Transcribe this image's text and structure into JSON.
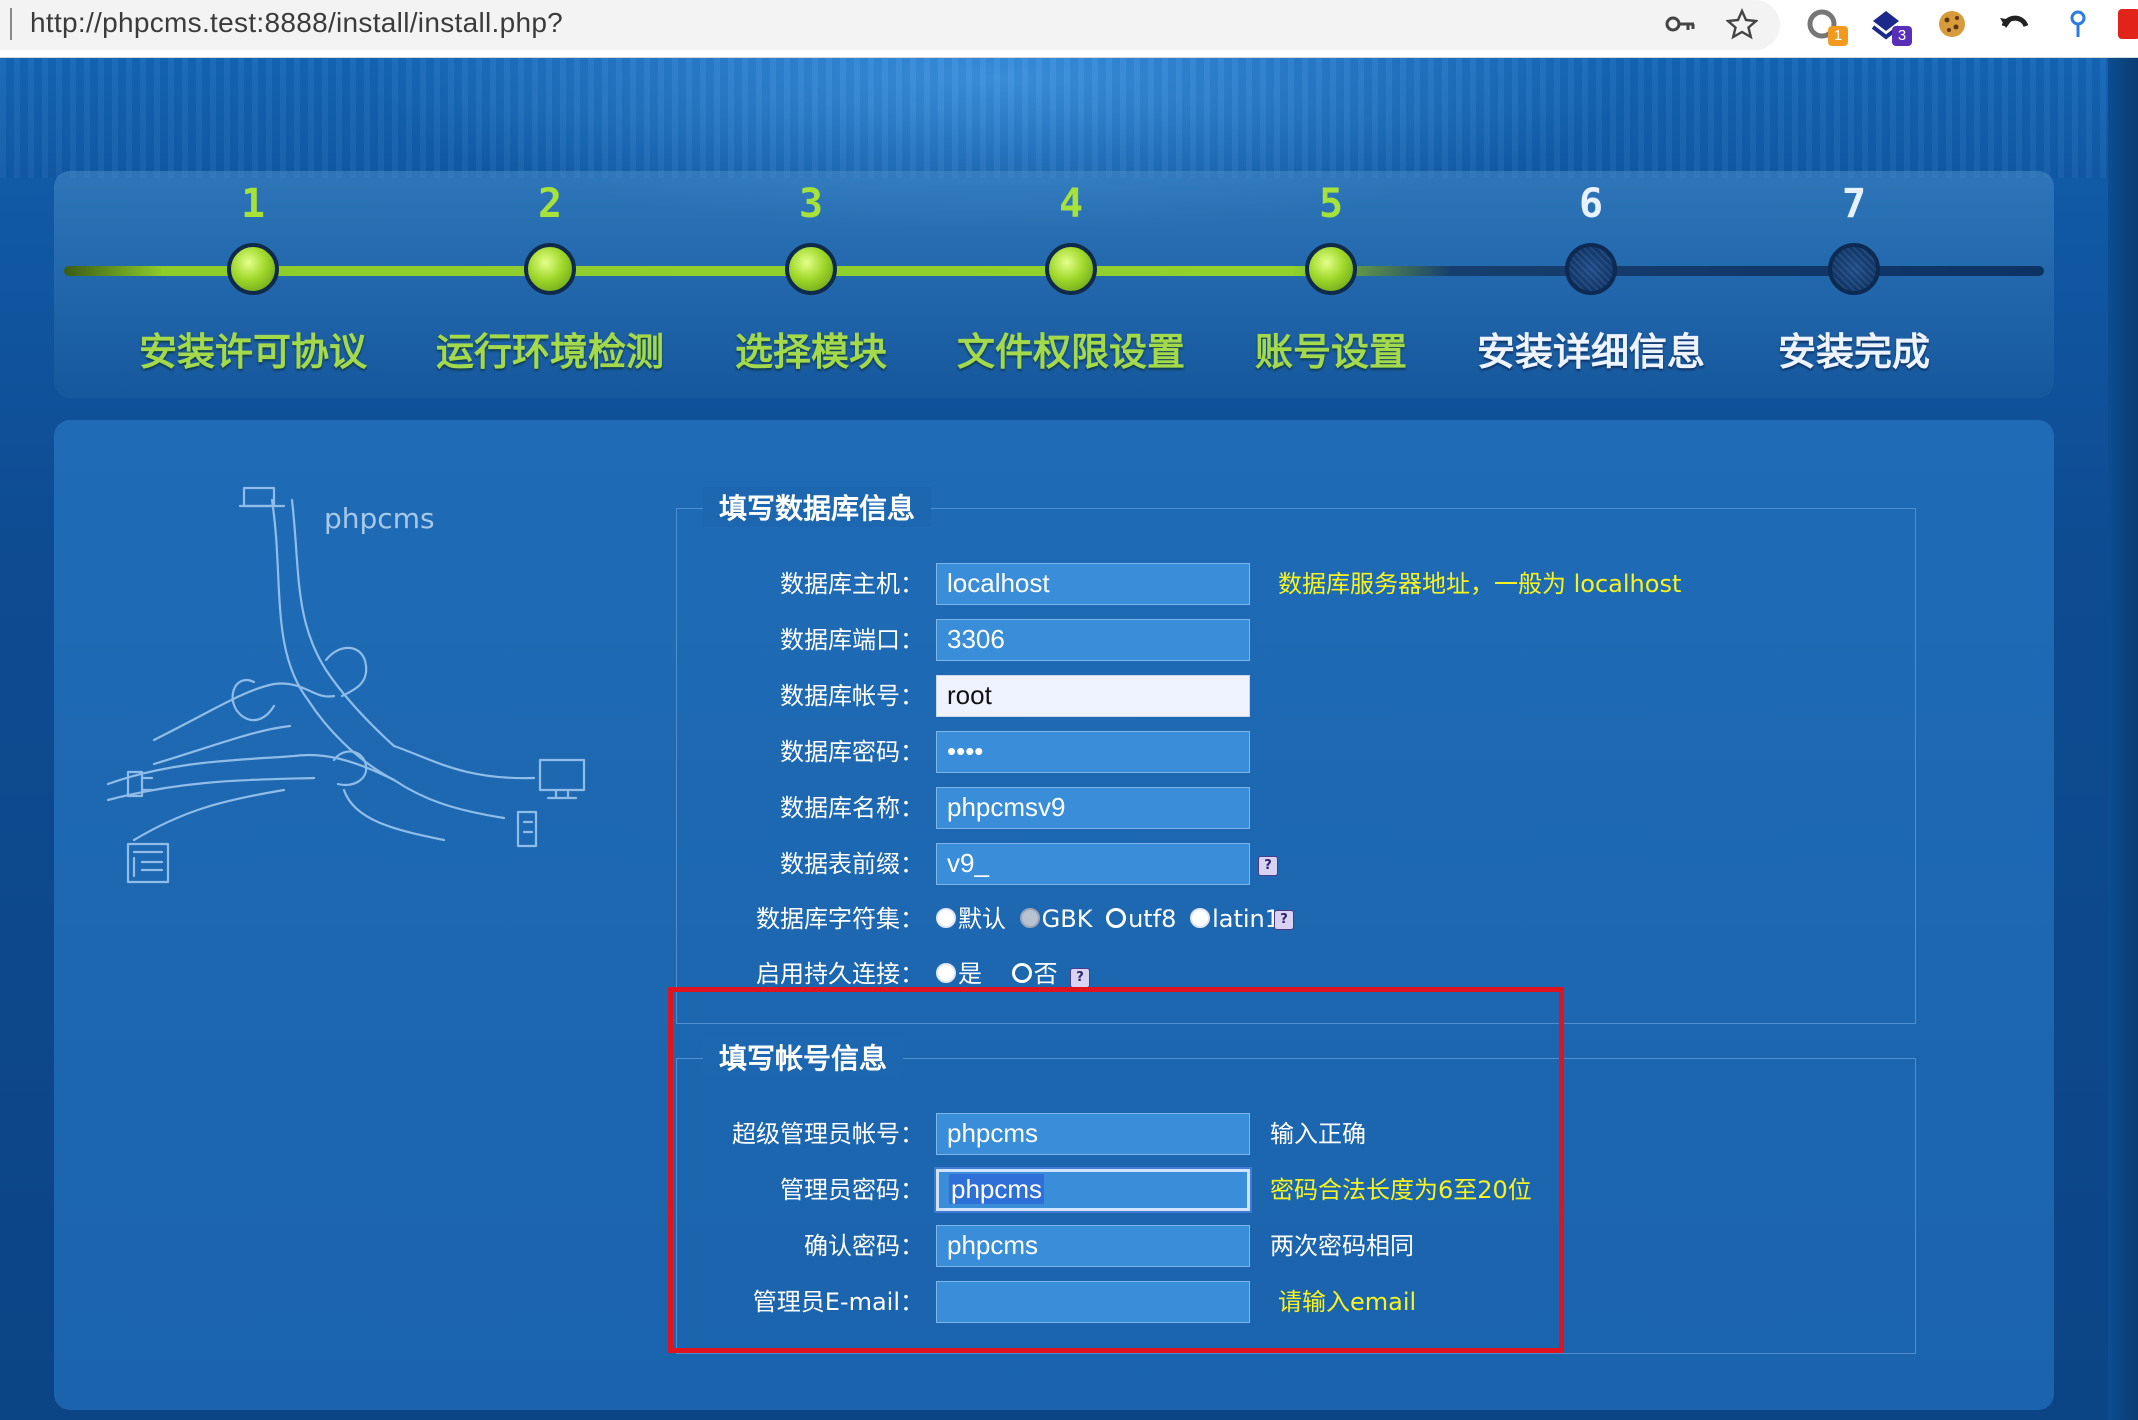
{
  "browser": {
    "url": "http://phpcms.test:8888/install/install.php?",
    "icons": [
      "key-icon",
      "star-icon",
      "extension-refresh-icon",
      "extension-shield-icon",
      "cookie-icon",
      "undo-icon",
      "pin-icon",
      "extension-red-icon"
    ],
    "badges": {
      "ext1": "1",
      "ext2": "3"
    }
  },
  "steps": [
    {
      "num": "1",
      "label": "安装许可协议",
      "state": "done"
    },
    {
      "num": "2",
      "label": "运行环境检测",
      "state": "done"
    },
    {
      "num": "3",
      "label": "选择模块",
      "state": "done"
    },
    {
      "num": "4",
      "label": "文件权限设置",
      "state": "done"
    },
    {
      "num": "5",
      "label": "账号设置",
      "state": "done"
    },
    {
      "num": "6",
      "label": "安装详细信息",
      "state": "todo"
    },
    {
      "num": "7",
      "label": "安装完成",
      "state": "todo"
    }
  ],
  "brand": "phpcms",
  "db": {
    "legend": "填写数据库信息",
    "host_label": "数据库主机：",
    "host_value": "localhost",
    "host_hint": "数据库服务器地址，一般为 localhost",
    "port_label": "数据库端口：",
    "port_value": "3306",
    "user_label": "数据库帐号：",
    "user_value": "root",
    "pass_label": "数据库密码：",
    "pass_value": "••••",
    "name_label": "数据库名称：",
    "name_value": "phpcmsv9",
    "prefix_label": "数据表前缀：",
    "prefix_value": "v9_",
    "charset_label": "数据库字符集：",
    "charset_options": [
      "默认",
      "GBK",
      "utf8",
      "latin1"
    ],
    "charset_selected": "utf8",
    "pconnect_label": "启用持久连接：",
    "pconnect_options": [
      "是",
      "否"
    ],
    "pconnect_selected": "否",
    "help": "?"
  },
  "account": {
    "legend": "填写帐号信息",
    "admin_label": "超级管理员帐号：",
    "admin_value": "phpcms",
    "admin_hint": "输入正确",
    "pwd_label": "管理员密码：",
    "pwd_value": "phpcms",
    "pwd_hint": "密码合法长度为6至20位",
    "pwd2_label": "确认密码：",
    "pwd2_value": "phpcms",
    "pwd2_hint": "两次密码相同",
    "email_label": "管理员E-mail：",
    "email_value": "",
    "email_hint": "请输入email"
  },
  "colors": {
    "accent_green": "#a3d94a",
    "hint_yellow": "#f7f320",
    "highlight_red": "#e0141e",
    "panel_blue": "#1d67b0"
  }
}
